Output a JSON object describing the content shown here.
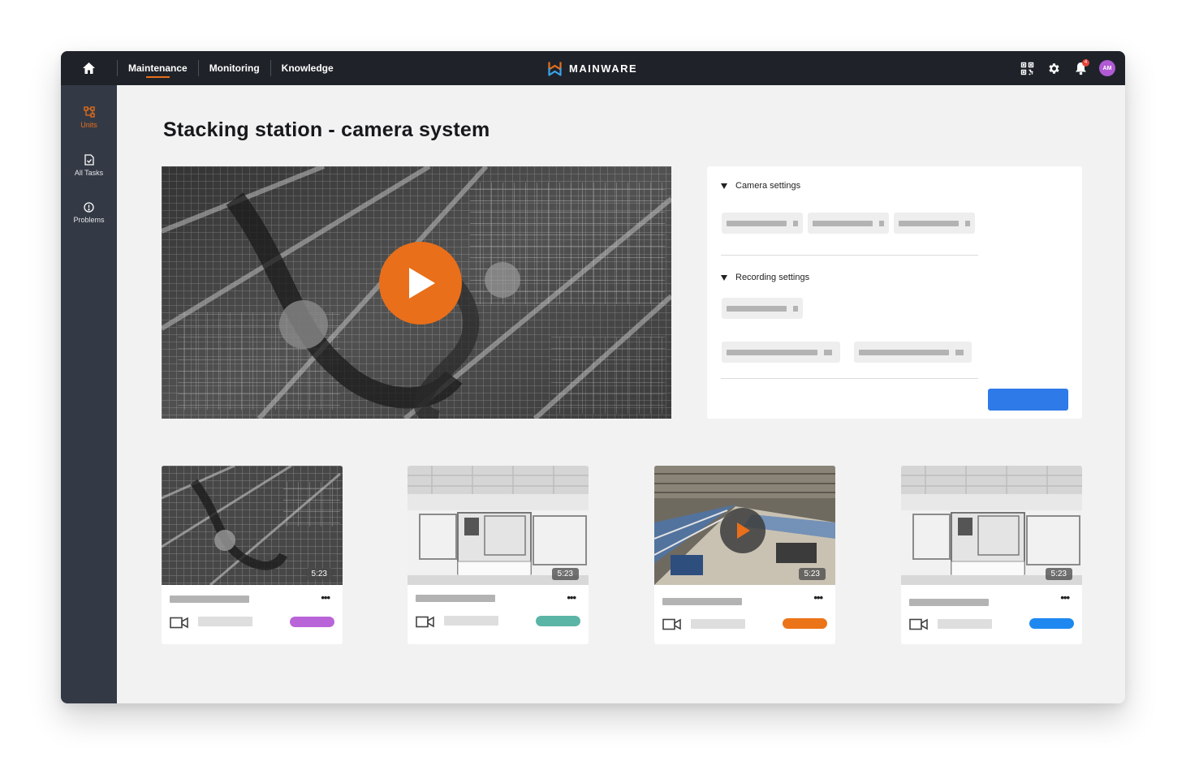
{
  "app": {
    "brand": "MAINWARE"
  },
  "topnav": {
    "items": [
      {
        "label": "Maintenance",
        "active": true
      },
      {
        "label": "Monitoring",
        "active": false
      },
      {
        "label": "Knowledge",
        "active": false
      }
    ],
    "icons": [
      "home-icon",
      "qr-code-icon",
      "gear-icon",
      "bell-icon"
    ],
    "notification_count": "4",
    "avatar_initials": "AM"
  },
  "sidebar": {
    "items": [
      {
        "label": "Units",
        "icon": "units-icon",
        "active": true
      },
      {
        "label": "All Tasks",
        "icon": "task-file-icon",
        "active": false
      },
      {
        "label": "Problems",
        "icon": "alert-circle-icon",
        "active": false
      }
    ]
  },
  "page": {
    "title": "Stacking station - camera system"
  },
  "settings": {
    "camera_settings": "Camera settings",
    "recording_settings": "Recording settings"
  },
  "videos": [
    {
      "duration": "5:23",
      "tag_color": "#b964d8"
    },
    {
      "duration": "5:23",
      "tag_color": "#5bb5a6"
    },
    {
      "duration": "5:23",
      "tag_color": "#eb7418"
    },
    {
      "duration": "5:23",
      "tag_color": "#1f88f0"
    }
  ],
  "colors": {
    "accent": "#e96f1a",
    "primary_button": "#2d7ae8",
    "topbar": "#1f2329",
    "sidebar": "#343a45"
  }
}
